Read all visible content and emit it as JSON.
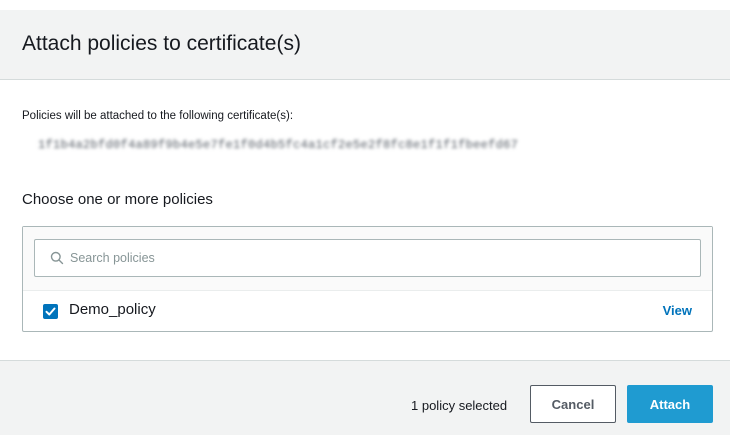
{
  "modal": {
    "title": "Attach policies to certificate(s)"
  },
  "body": {
    "info_text": "Policies will be attached to the following certificate(s):",
    "certificate_id": "1f1b4a2bfd0f4a89f9b4e5e7fe1f0d4b5fc4a1cf2e5e2f8fc8e1f1f1fbeefd67",
    "choose_label": "Choose one or more policies"
  },
  "search": {
    "placeholder": "Search policies",
    "value": ""
  },
  "policies": [
    {
      "name": "Demo_policy",
      "checked": true,
      "view_label": "View"
    }
  ],
  "footer": {
    "selected_count": "1 policy selected",
    "cancel_label": "Cancel",
    "attach_label": "Attach"
  },
  "colors": {
    "primary": "#1f9bd1",
    "link": "#0073bb",
    "checkbox": "#0073bb",
    "header_bg": "#f2f3f3"
  },
  "icons": {
    "search": "search-icon",
    "checkbox_check": "check-icon"
  }
}
